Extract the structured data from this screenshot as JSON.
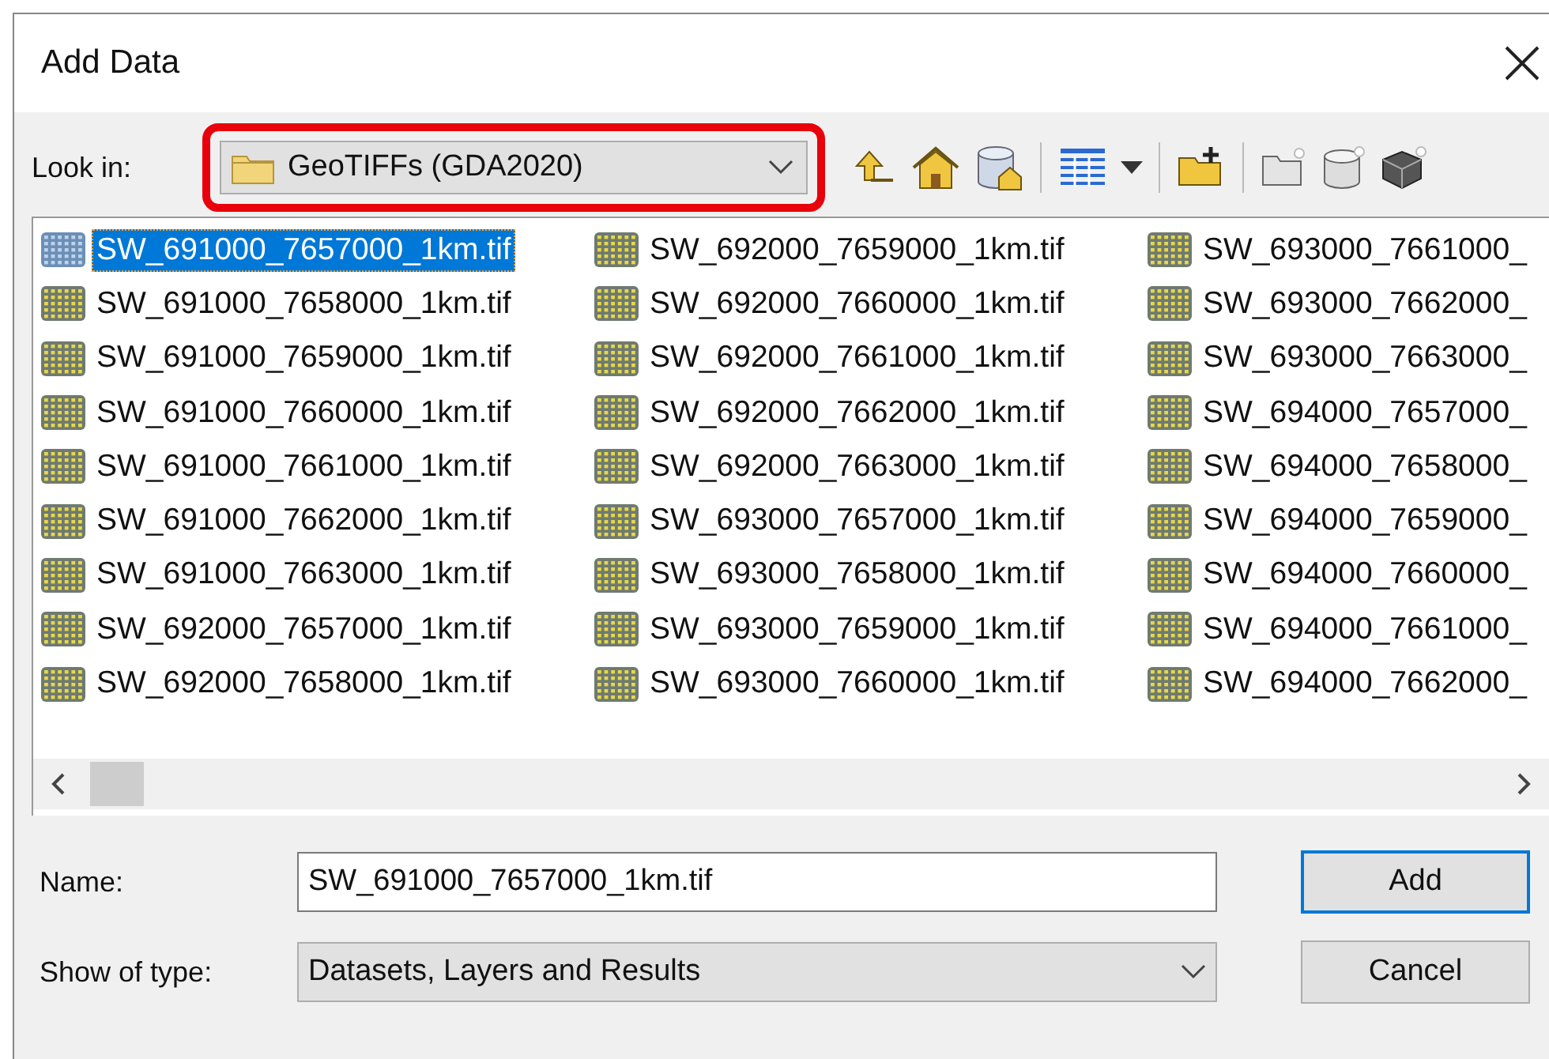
{
  "window": {
    "title": "Add Data"
  },
  "look_in": {
    "label": "Look in:",
    "value": "GeoTIFFs (GDA2020)",
    "highlighted": true
  },
  "files": [
    {
      "name": "SW_691000_7657000_1km.tif",
      "selected": true
    },
    {
      "name": "SW_691000_7658000_1km.tif",
      "selected": false
    },
    {
      "name": "SW_691000_7659000_1km.tif",
      "selected": false
    },
    {
      "name": "SW_691000_7660000_1km.tif",
      "selected": false
    },
    {
      "name": "SW_691000_7661000_1km.tif",
      "selected": false
    },
    {
      "name": "SW_691000_7662000_1km.tif",
      "selected": false
    },
    {
      "name": "SW_691000_7663000_1km.tif",
      "selected": false
    },
    {
      "name": "SW_692000_7657000_1km.tif",
      "selected": false
    },
    {
      "name": "SW_692000_7658000_1km.tif",
      "selected": false
    },
    {
      "name": "SW_692000_7659000_1km.tif",
      "selected": false
    },
    {
      "name": "SW_692000_7660000_1km.tif",
      "selected": false
    },
    {
      "name": "SW_692000_7661000_1km.tif",
      "selected": false
    },
    {
      "name": "SW_692000_7662000_1km.tif",
      "selected": false
    },
    {
      "name": "SW_692000_7663000_1km.tif",
      "selected": false
    },
    {
      "name": "SW_693000_7657000_1km.tif",
      "selected": false
    },
    {
      "name": "SW_693000_7658000_1km.tif",
      "selected": false
    },
    {
      "name": "SW_693000_7659000_1km.tif",
      "selected": false
    },
    {
      "name": "SW_693000_7660000_1km.tif",
      "selected": false
    },
    {
      "name": "SW_693000_7661000_",
      "selected": false
    },
    {
      "name": "SW_693000_7662000_",
      "selected": false
    },
    {
      "name": "SW_693000_7663000_",
      "selected": false
    },
    {
      "name": "SW_694000_7657000_",
      "selected": false
    },
    {
      "name": "SW_694000_7658000_",
      "selected": false
    },
    {
      "name": "SW_694000_7659000_",
      "selected": false
    },
    {
      "name": "SW_694000_7660000_",
      "selected": false
    },
    {
      "name": "SW_694000_7661000_",
      "selected": false
    },
    {
      "name": "SW_694000_7662000_",
      "selected": false
    }
  ],
  "name_field": {
    "label": "Name:",
    "value": "SW_691000_7657000_1km.tif"
  },
  "type_field": {
    "label": "Show of type:",
    "value": "Datasets, Layers and Results"
  },
  "buttons": [
    {
      "label": "Add",
      "default": true
    },
    {
      "label": "Cancel",
      "default": false
    }
  ]
}
